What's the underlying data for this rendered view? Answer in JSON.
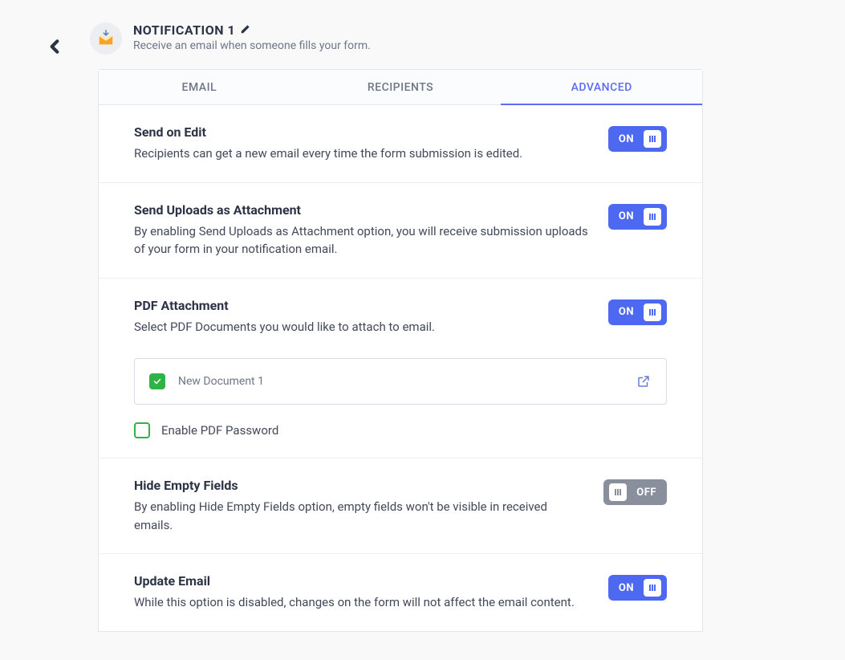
{
  "header": {
    "title": "NOTIFICATION 1",
    "description": "Receive an email when someone fills your form."
  },
  "tabs": {
    "email": "EMAIL",
    "recipients": "RECIPIENTS",
    "advanced": "ADVANCED"
  },
  "toggle_labels": {
    "on": "ON",
    "off": "OFF"
  },
  "sections": {
    "send_on_edit": {
      "title": "Send on Edit",
      "desc": "Recipients can get a new email every time the form submission is edited.",
      "value": "on"
    },
    "send_uploads": {
      "title": "Send Uploads as Attachment",
      "desc": "By enabling Send Uploads as Attachment option, you will receive submission uploads of your form in your notification email.",
      "value": "on"
    },
    "pdf_attachment": {
      "title": "PDF Attachment",
      "desc": "Select PDF Documents you would like to attach to email.",
      "value": "on",
      "document": "New Document 1",
      "enable_password_label": "Enable PDF Password"
    },
    "hide_empty": {
      "title": "Hide Empty Fields",
      "desc": "By enabling Hide Empty Fields option, empty fields won't be visible in received emails.",
      "value": "off"
    },
    "update_email": {
      "title": "Update Email",
      "desc": "While this option is disabled, changes on the form will not affect the email content.",
      "value": "on"
    }
  }
}
